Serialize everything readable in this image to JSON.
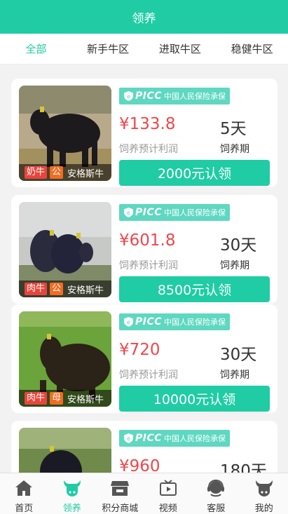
{
  "header": {
    "title": "领养"
  },
  "tabs": [
    {
      "label": "全部",
      "active": true
    },
    {
      "label": "新手牛区",
      "active": false
    },
    {
      "label": "进取牛区",
      "active": false
    },
    {
      "label": "稳健牛区",
      "active": false
    }
  ],
  "insurance": {
    "brand": "PICC",
    "text": "中国人民保险承保"
  },
  "cards": [
    {
      "type_tag": "奶牛",
      "sex_tag": "公",
      "breed": "安格斯牛",
      "profit": "¥133.8",
      "profit_label": "饲养预计利润",
      "days": "5天",
      "days_label": "饲养期",
      "button": "2000元认领"
    },
    {
      "type_tag": "肉牛",
      "sex_tag": "公",
      "breed": "安格斯牛",
      "profit": "¥601.8",
      "profit_label": "饲养预计利润",
      "days": "30天",
      "days_label": "饲养期",
      "button": "8500元认领"
    },
    {
      "type_tag": "肉牛",
      "sex_tag": "母",
      "breed": "安格斯牛",
      "profit": "¥720",
      "profit_label": "饲养预计利润",
      "days": "30天",
      "days_label": "饲养期",
      "button": "10000元认领"
    },
    {
      "type_tag": "",
      "sex_tag": "",
      "breed": "",
      "profit": "¥960",
      "profit_label": "",
      "days": "180天",
      "days_label": "",
      "button": ""
    }
  ],
  "bottom_nav": [
    {
      "label": "首页",
      "icon": "home-icon",
      "active": false
    },
    {
      "label": "领养",
      "icon": "cow-icon",
      "active": true
    },
    {
      "label": "积分商城",
      "icon": "store-icon",
      "active": false
    },
    {
      "label": "视频",
      "icon": "video-icon",
      "active": false
    },
    {
      "label": "客服",
      "icon": "headset-icon",
      "active": false
    },
    {
      "label": "我的",
      "icon": "profile-icon",
      "active": false
    }
  ],
  "colors": {
    "accent": "#1fcca4",
    "price": "#f0464b",
    "type_tag": "#e8453c",
    "sex_tag": "#f26b21",
    "insurance_badge": "#5ed8c0"
  }
}
